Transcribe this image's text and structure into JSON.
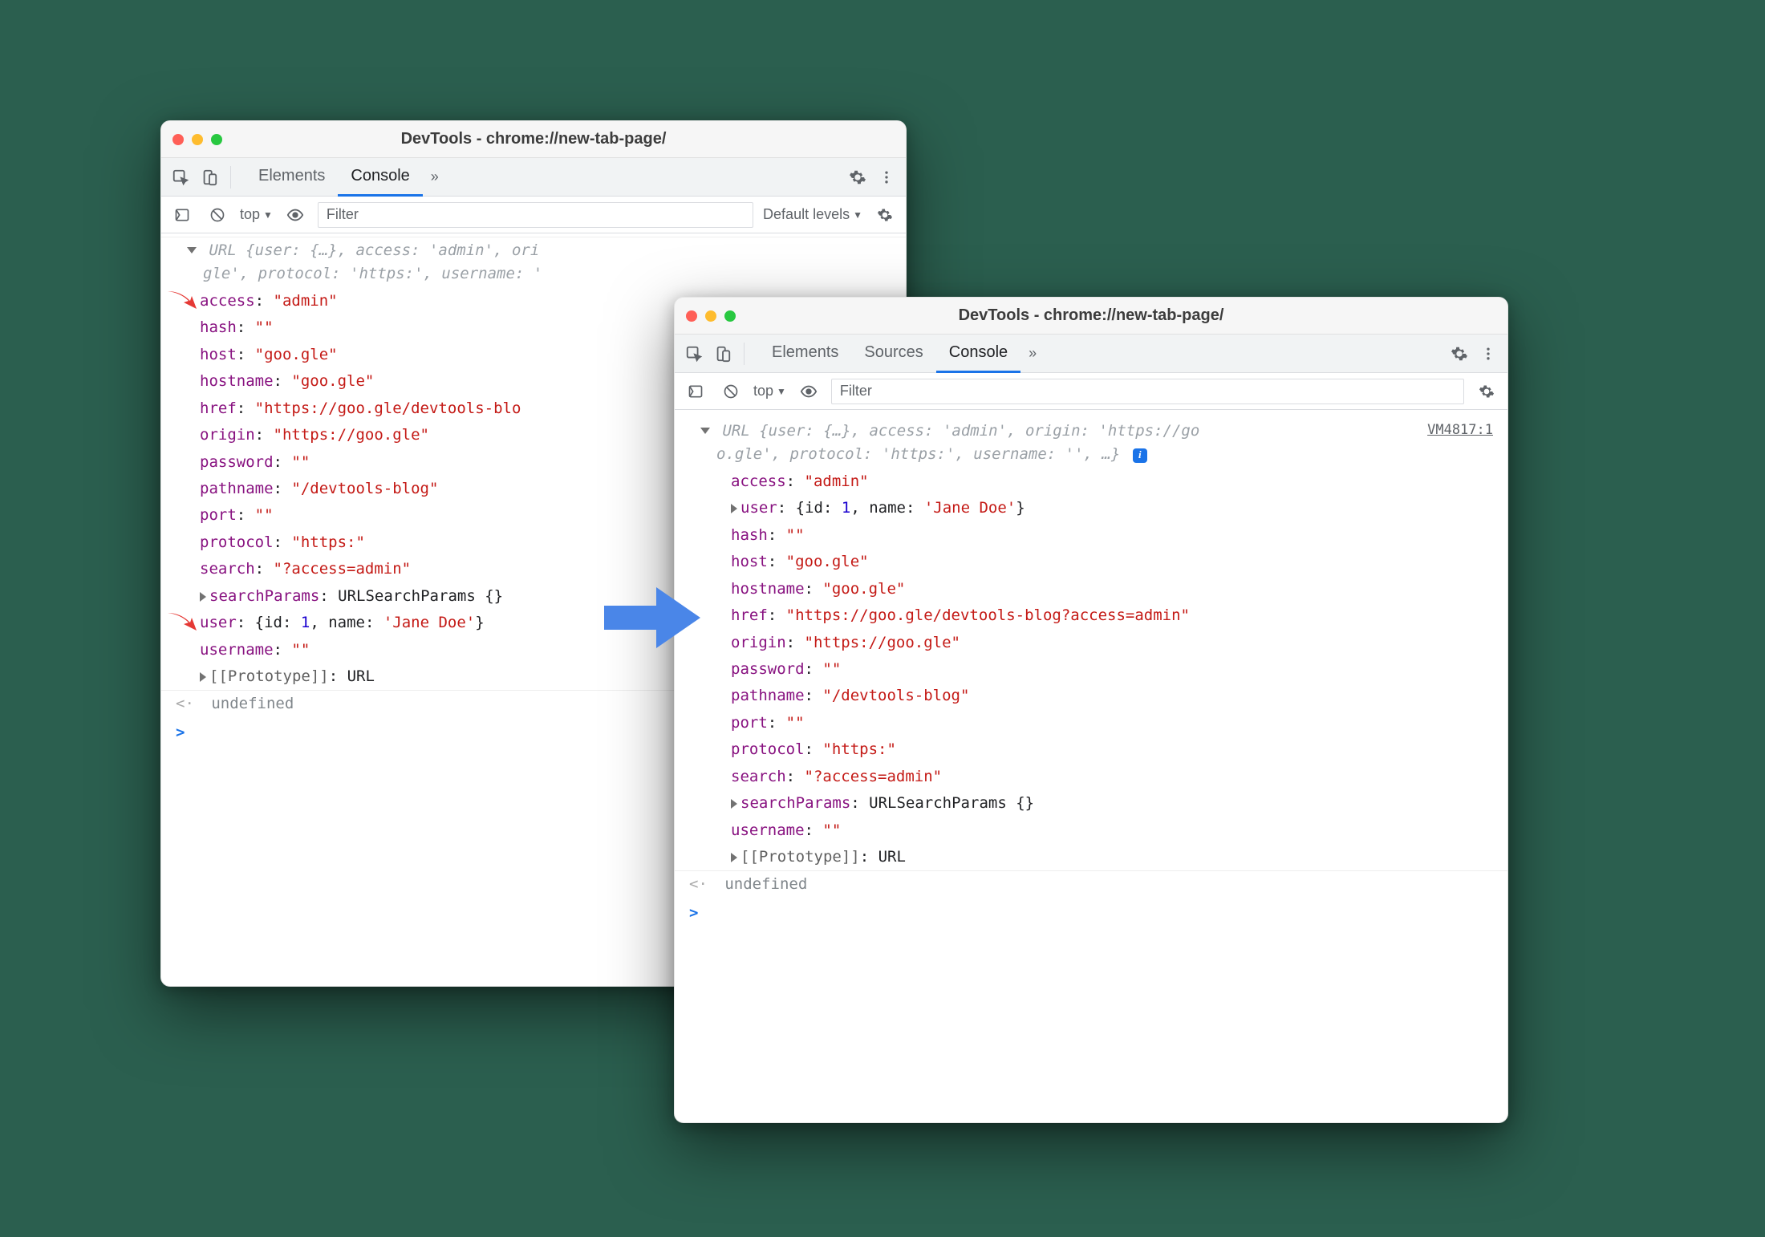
{
  "windowTitle": "DevTools - chrome://new-tab-page/",
  "tabs": {
    "elements": "Elements",
    "sources": "Sources",
    "console": "Console"
  },
  "subbar": {
    "context": "top",
    "filterPlaceholder": "Filter",
    "levels": "Default levels"
  },
  "left": {
    "summary_prefix": "URL ",
    "summary_body": "{user: {…}, access: 'admin', origin: 'https://goo.gle', protocol: 'https:', username: '",
    "truncated_line1": "URL {user: {…}, access: 'admin', ori",
    "truncated_line2": "gle', protocol: 'https:', username: '",
    "props": [
      {
        "k": "access",
        "v": "\"admin\"",
        "t": "s",
        "arrow": true
      },
      {
        "k": "hash",
        "v": "\"\"",
        "t": "s"
      },
      {
        "k": "host",
        "v": "\"goo.gle\"",
        "t": "s"
      },
      {
        "k": "hostname",
        "v": "\"goo.gle\"",
        "t": "s"
      },
      {
        "k": "href",
        "v": "\"https://goo.gle/devtools-blo",
        "t": "s"
      },
      {
        "k": "origin",
        "v": "\"https://goo.gle\"",
        "t": "s"
      },
      {
        "k": "password",
        "v": "\"\"",
        "t": "s"
      },
      {
        "k": "pathname",
        "v": "\"/devtools-blog\"",
        "t": "s"
      },
      {
        "k": "port",
        "v": "\"\"",
        "t": "s"
      },
      {
        "k": "protocol",
        "v": "\"https:\"",
        "t": "s"
      },
      {
        "k": "search",
        "v": "\"?access=admin\"",
        "t": "s"
      },
      {
        "k": "searchParams",
        "v": "URLSearchParams {}",
        "t": "obj",
        "expand": true
      },
      {
        "k": "user",
        "v": "{id: 1, name: 'Jane Doe'}",
        "t": "mix",
        "arrow": true
      },
      {
        "k": "username",
        "v": "\"\"",
        "t": "s"
      },
      {
        "k": "[[Prototype]]",
        "v": "URL",
        "t": "obj",
        "expand": true,
        "state": true
      }
    ],
    "undefined": "undefined"
  },
  "right": {
    "source": "VM4817:1",
    "line1": "URL {user: {…}, access: 'admin', origin: 'https://go",
    "line2": "o.gle', protocol: 'https:', username: '', …}",
    "props": [
      {
        "k": "access",
        "v": "\"admin\"",
        "t": "s"
      },
      {
        "k": "user",
        "v": "{id: 1, name: 'Jane Doe'}",
        "t": "mix",
        "expand": true
      },
      {
        "k": "hash",
        "v": "\"\"",
        "t": "s"
      },
      {
        "k": "host",
        "v": "\"goo.gle\"",
        "t": "s"
      },
      {
        "k": "hostname",
        "v": "\"goo.gle\"",
        "t": "s"
      },
      {
        "k": "href",
        "v": "\"https://goo.gle/devtools-blog?access=admin\"",
        "t": "s"
      },
      {
        "k": "origin",
        "v": "\"https://goo.gle\"",
        "t": "s"
      },
      {
        "k": "password",
        "v": "\"\"",
        "t": "s"
      },
      {
        "k": "pathname",
        "v": "\"/devtools-blog\"",
        "t": "s"
      },
      {
        "k": "port",
        "v": "\"\"",
        "t": "s"
      },
      {
        "k": "protocol",
        "v": "\"https:\"",
        "t": "s"
      },
      {
        "k": "search",
        "v": "\"?access=admin\"",
        "t": "s"
      },
      {
        "k": "searchParams",
        "v": "URLSearchParams {}",
        "t": "obj",
        "expand": true
      },
      {
        "k": "username",
        "v": "\"\"",
        "t": "s"
      },
      {
        "k": "[[Prototype]]",
        "v": "URL",
        "t": "obj",
        "expand": true,
        "state": true
      }
    ],
    "undefined": "undefined"
  }
}
